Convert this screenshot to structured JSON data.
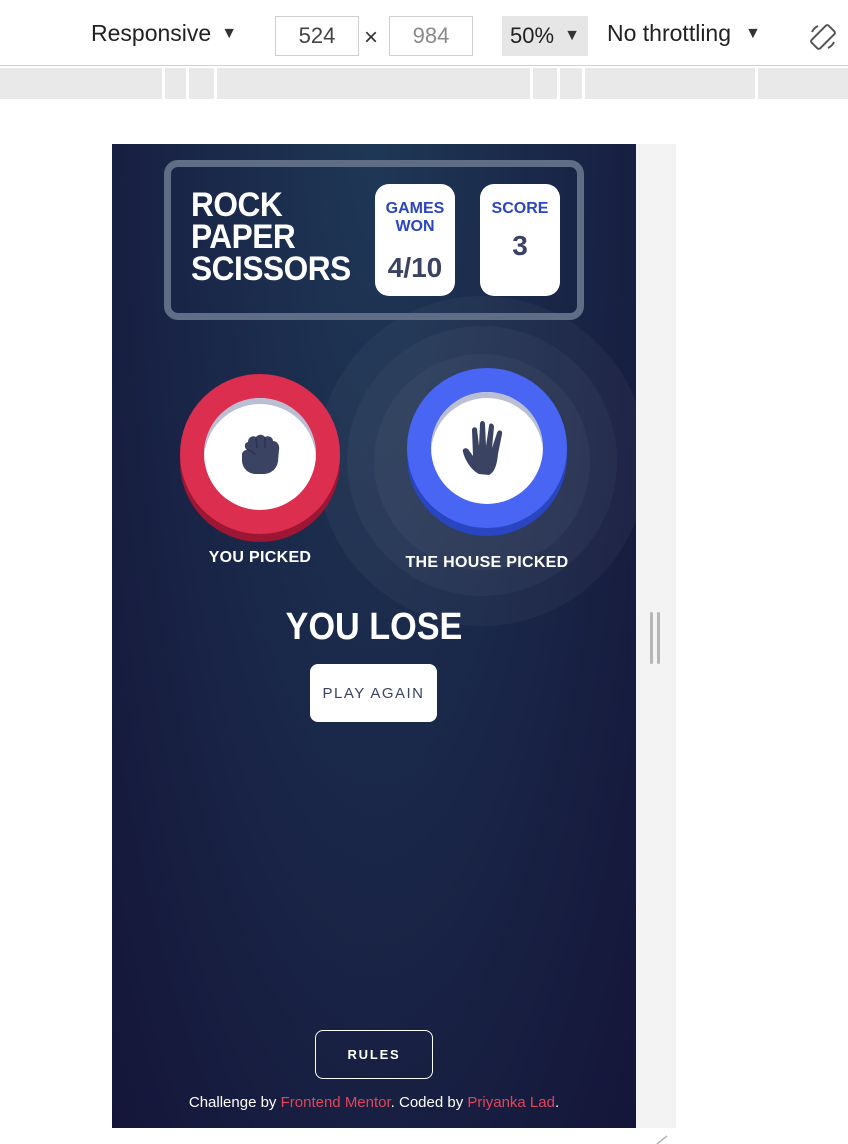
{
  "devtools": {
    "device": "Responsive",
    "width": "524",
    "height": "984",
    "times": "×",
    "zoom": "50%",
    "throttling": "No throttling",
    "caret": "▼"
  },
  "game": {
    "title_lines": [
      "ROCK",
      "PAPER",
      "SCISSORS"
    ],
    "games_won_label": "GAMES WON",
    "games_won_value": "4/10",
    "score_label": "SCORE",
    "score_value": "3",
    "player_pick": "rock",
    "house_pick": "paper",
    "you_picked_label": "YOU PICKED",
    "house_picked_label": "THE HOUSE PICKED",
    "result": "YOU LOSE",
    "play_again": "PLAY AGAIN",
    "rules": "RULES",
    "colors": {
      "rock": "#dc2e4e",
      "paper": "#4865f4",
      "background_top": "#1f3756",
      "background_bottom": "#141539",
      "score_label": "#2a45c2",
      "link": "#e2445a"
    }
  },
  "footer": {
    "prefix": "Challenge by ",
    "link1": "Frontend Mentor",
    "middle": ". Coded by ",
    "link2": "Priyanka Lad",
    "suffix": "."
  }
}
